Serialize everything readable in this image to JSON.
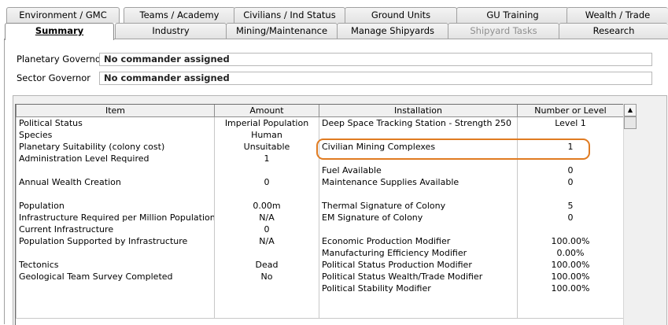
{
  "tabs_row1": [
    "Environment / GMC",
    "Teams / Academy",
    "Civilians / Ind Status",
    "Ground Units",
    "GU Training",
    "Wealth / Trade"
  ],
  "tabs_row2": [
    "Summary",
    "Industry",
    "Mining/Maintenance",
    "Manage Shipyards",
    "Shipyard Tasks",
    "Research"
  ],
  "active_tab": "Summary",
  "disabled_tab": "Shipyard Tasks",
  "governors": {
    "planetary": {
      "label": "Planetary Governor",
      "value": "No commander assigned"
    },
    "sector": {
      "label": "Sector Governor",
      "value": "No commander assigned"
    }
  },
  "table": {
    "columns": [
      "Item",
      "Amount",
      "Installation",
      "Number or Level"
    ],
    "rows": [
      [
        "Political Status",
        "Imperial Population",
        "Deep Space Tracking Station - Strength 250",
        "Level 1"
      ],
      [
        "Species",
        "Human",
        "",
        ""
      ],
      [
        "Planetary Suitability (colony cost)",
        "Unsuitable",
        "Civilian Mining Complexes",
        "1"
      ],
      [
        "Administration Level Required",
        "1",
        "",
        ""
      ],
      [
        "",
        "",
        "Fuel Available",
        "0"
      ],
      [
        "Annual Wealth Creation",
        "0",
        "Maintenance Supplies Available",
        "0"
      ],
      [
        "",
        "",
        "",
        ""
      ],
      [
        "Population",
        "0.00m",
        "Thermal Signature of Colony",
        "5"
      ],
      [
        "Infrastructure Required per Million Population",
        "N/A",
        "EM Signature of Colony",
        "0"
      ],
      [
        "Current Infrastructure",
        "0",
        "",
        ""
      ],
      [
        "Population Supported by Infrastructure",
        "N/A",
        "Economic Production Modifier",
        "100.00%"
      ],
      [
        "",
        "",
        "Manufacturing Efficiency Modifier",
        "0.00%"
      ],
      [
        "Tectonics",
        "Dead",
        "Political Status Production Modifier",
        "100.00%"
      ],
      [
        "Geological Team Survey Completed",
        "No",
        "Political Status Wealth/Trade Modifier",
        "100.00%"
      ],
      [
        "",
        "",
        "Political Stability Modifier",
        "100.00%"
      ],
      [
        "",
        "",
        "",
        ""
      ],
      [
        "",
        "",
        "",
        ""
      ]
    ]
  },
  "highlight_color": "#e07b21",
  "scrollbar": {
    "up_icon": "triangle-up-icon"
  }
}
